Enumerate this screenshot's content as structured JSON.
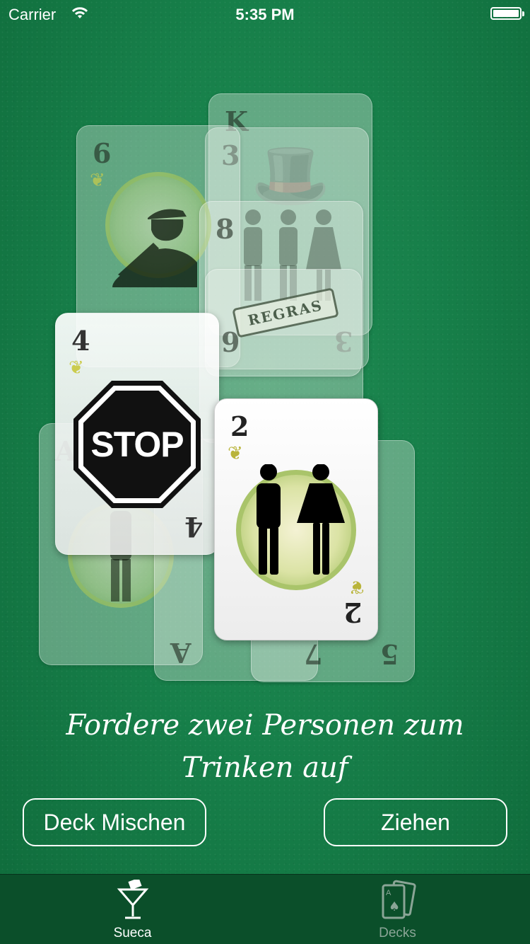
{
  "status_bar": {
    "carrier": "Carrier",
    "time": "5:35 PM"
  },
  "cards": [
    {
      "rank": "K",
      "state": "faded"
    },
    {
      "rank": "3",
      "state": "faded"
    },
    {
      "rank": "6",
      "state": "faded",
      "figure": "saluting-soldier"
    },
    {
      "rank": "8",
      "state": "faded",
      "figure": "three-people"
    },
    {
      "rank": "9",
      "state": "faded",
      "figure": "regras-scroll",
      "label": "REGRAS"
    },
    {
      "rank": "A",
      "state": "faded",
      "figure": "person"
    },
    {
      "rank": "7",
      "state": "faded"
    },
    {
      "rank": "5",
      "state": "faded"
    },
    {
      "rank": "4",
      "state": "mid",
      "figure": "stop-sign",
      "label": "STOP"
    },
    {
      "rank": "2",
      "state": "front",
      "figure": "man-and-woman"
    }
  ],
  "instruction": "Fordere zwei Personen zum Trinken auf",
  "buttons": {
    "shuffle": "Deck Mischen",
    "draw": "Ziehen"
  },
  "tabs": [
    {
      "label": "Sueca",
      "icon": "cocktail-glass-icon",
      "selected": true
    },
    {
      "label": "Decks",
      "icon": "playing-cards-icon",
      "selected": false
    }
  ]
}
